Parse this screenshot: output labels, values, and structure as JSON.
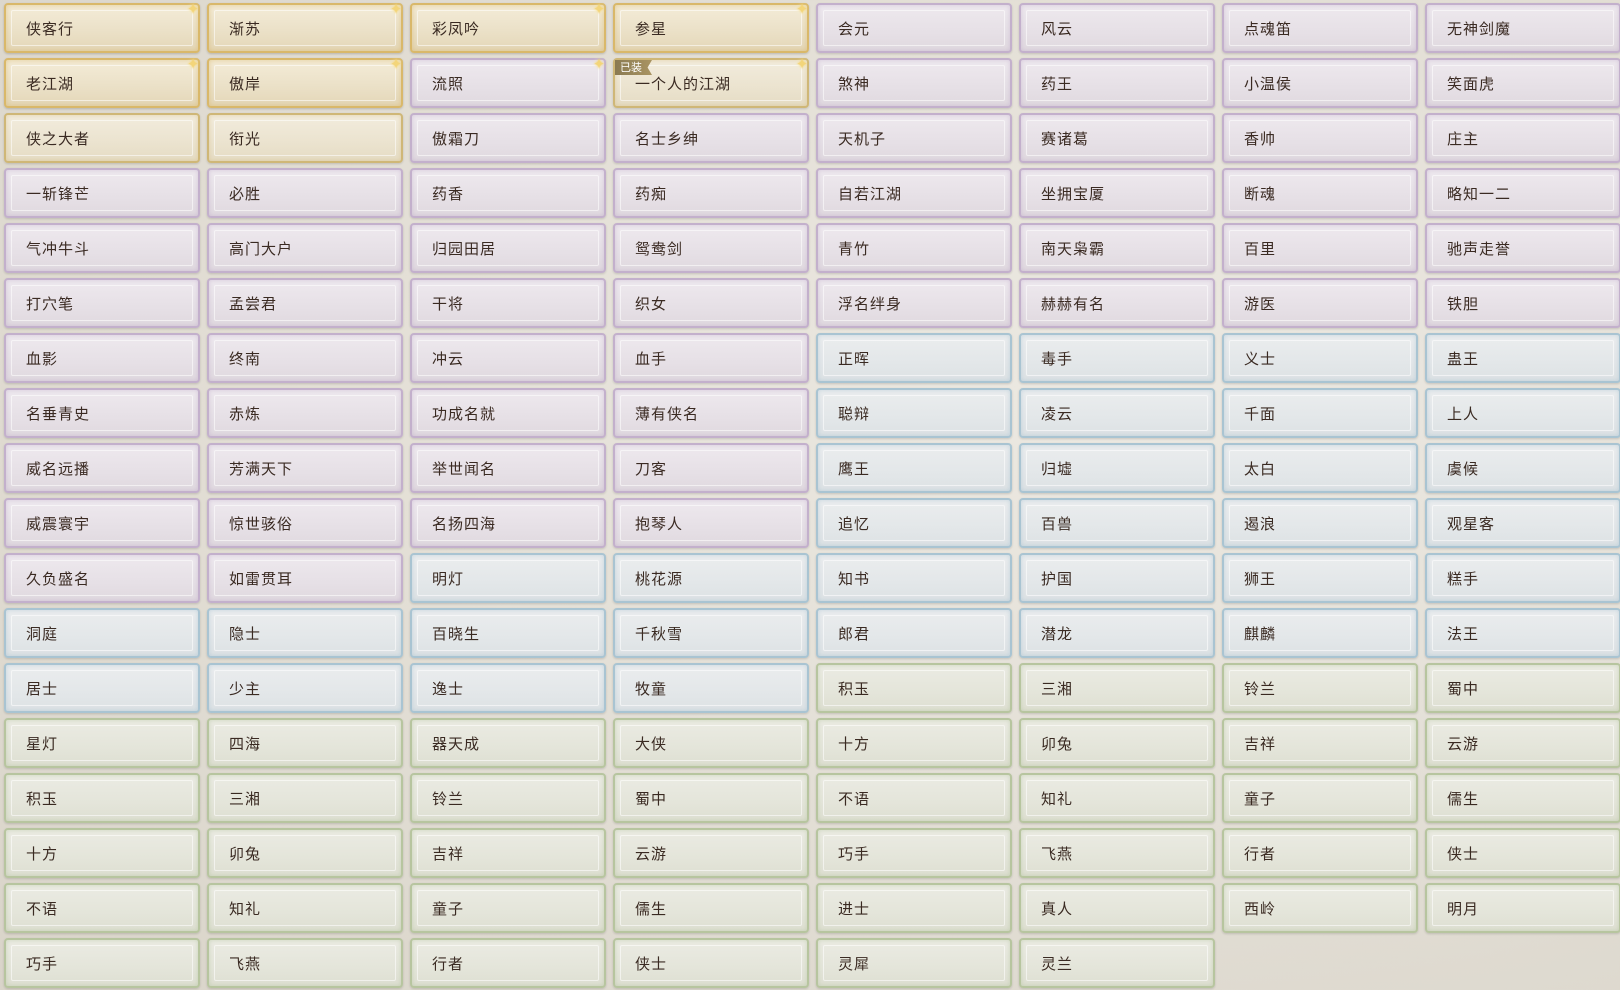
{
  "equipped_badge": "已装",
  "titles": [
    {
      "label": "侠客行",
      "tier": "gold",
      "sparkle": true
    },
    {
      "label": "渐苏",
      "tier": "gold",
      "sparkle": true
    },
    {
      "label": "彩凤吟",
      "tier": "gold",
      "sparkle": true
    },
    {
      "label": "参星",
      "tier": "gold",
      "sparkle": true
    },
    {
      "label": "会元",
      "tier": "purple"
    },
    {
      "label": "风云",
      "tier": "purple"
    },
    {
      "label": "点魂笛",
      "tier": "purple"
    },
    {
      "label": "无神剑魔",
      "tier": "purple"
    },
    {
      "label": "老江湖",
      "tier": "gold",
      "sparkle": true
    },
    {
      "label": "傲岸",
      "tier": "gold",
      "sparkle": true
    },
    {
      "label": "流照",
      "tier": "purple",
      "sparkle": true
    },
    {
      "label": "一个人的江湖",
      "tier": "gold2",
      "sparkle": true,
      "equipped": true
    },
    {
      "label": "煞神",
      "tier": "purple"
    },
    {
      "label": "药王",
      "tier": "purple"
    },
    {
      "label": "小温侯",
      "tier": "purple"
    },
    {
      "label": "笑面虎",
      "tier": "purple"
    },
    {
      "label": "侠之大者",
      "tier": "gold2"
    },
    {
      "label": "衔光",
      "tier": "gold2"
    },
    {
      "label": "傲霜刀",
      "tier": "purple"
    },
    {
      "label": "名士乡绅",
      "tier": "purple"
    },
    {
      "label": "天机子",
      "tier": "purple"
    },
    {
      "label": "赛诸葛",
      "tier": "purple"
    },
    {
      "label": "香帅",
      "tier": "purple"
    },
    {
      "label": "庄主",
      "tier": "purple"
    },
    {
      "label": "一斩锋芒",
      "tier": "purple"
    },
    {
      "label": "必胜",
      "tier": "purple"
    },
    {
      "label": "药香",
      "tier": "purple"
    },
    {
      "label": "药痴",
      "tier": "purple"
    },
    {
      "label": "自若江湖",
      "tier": "purple"
    },
    {
      "label": "坐拥宝厦",
      "tier": "purple"
    },
    {
      "label": "断魂",
      "tier": "purple"
    },
    {
      "label": "略知一二",
      "tier": "purple"
    },
    {
      "label": "气冲牛斗",
      "tier": "purple"
    },
    {
      "label": "高门大户",
      "tier": "purple"
    },
    {
      "label": "归园田居",
      "tier": "purple"
    },
    {
      "label": "鸳鸯剑",
      "tier": "purple"
    },
    {
      "label": "青竹",
      "tier": "purple"
    },
    {
      "label": "南天枭霸",
      "tier": "purple"
    },
    {
      "label": "百里",
      "tier": "purple"
    },
    {
      "label": "驰声走誉",
      "tier": "purple"
    },
    {
      "label": "打穴笔",
      "tier": "purple"
    },
    {
      "label": "孟尝君",
      "tier": "purple"
    },
    {
      "label": "干将",
      "tier": "purple"
    },
    {
      "label": "织女",
      "tier": "purple"
    },
    {
      "label": "浮名绊身",
      "tier": "purple"
    },
    {
      "label": "赫赫有名",
      "tier": "purple"
    },
    {
      "label": "游医",
      "tier": "purple"
    },
    {
      "label": "铁胆",
      "tier": "purple"
    },
    {
      "label": "血影",
      "tier": "purple"
    },
    {
      "label": "终南",
      "tier": "purple"
    },
    {
      "label": "冲云",
      "tier": "purple"
    },
    {
      "label": "血手",
      "tier": "purple"
    },
    {
      "label": "正晖",
      "tier": "blue"
    },
    {
      "label": "毒手",
      "tier": "blue"
    },
    {
      "label": "义士",
      "tier": "blue"
    },
    {
      "label": "蛊王",
      "tier": "blue"
    },
    {
      "label": "名垂青史",
      "tier": "purple"
    },
    {
      "label": "赤炼",
      "tier": "purple"
    },
    {
      "label": "功成名就",
      "tier": "purple"
    },
    {
      "label": "薄有侠名",
      "tier": "purple"
    },
    {
      "label": "聪辩",
      "tier": "blue"
    },
    {
      "label": "凌云",
      "tier": "blue"
    },
    {
      "label": "千面",
      "tier": "blue"
    },
    {
      "label": "上人",
      "tier": "blue"
    },
    {
      "label": "威名远播",
      "tier": "purple"
    },
    {
      "label": "芳满天下",
      "tier": "purple"
    },
    {
      "label": "举世闻名",
      "tier": "purple"
    },
    {
      "label": "刀客",
      "tier": "purple"
    },
    {
      "label": "鹰王",
      "tier": "blue"
    },
    {
      "label": "归墟",
      "tier": "blue"
    },
    {
      "label": "太白",
      "tier": "blue"
    },
    {
      "label": "虞候",
      "tier": "blue"
    },
    {
      "label": "威震寰宇",
      "tier": "purple"
    },
    {
      "label": "惊世骇俗",
      "tier": "purple"
    },
    {
      "label": "名扬四海",
      "tier": "purple"
    },
    {
      "label": "抱琴人",
      "tier": "purple"
    },
    {
      "label": "追忆",
      "tier": "blue"
    },
    {
      "label": "百兽",
      "tier": "blue"
    },
    {
      "label": "遏浪",
      "tier": "blue"
    },
    {
      "label": "观星客",
      "tier": "blue"
    },
    {
      "label": "久负盛名",
      "tier": "purple"
    },
    {
      "label": "如雷贯耳",
      "tier": "purple"
    },
    {
      "label": "明灯",
      "tier": "blue"
    },
    {
      "label": "桃花源",
      "tier": "blue"
    },
    {
      "label": "知书",
      "tier": "blue"
    },
    {
      "label": "护国",
      "tier": "blue"
    },
    {
      "label": "狮王",
      "tier": "blue"
    },
    {
      "label": "糕手",
      "tier": "blue"
    },
    {
      "label": "洞庭",
      "tier": "blue"
    },
    {
      "label": "隐士",
      "tier": "blue"
    },
    {
      "label": "百晓生",
      "tier": "blue"
    },
    {
      "label": "千秋雪",
      "tier": "blue"
    },
    {
      "label": "郎君",
      "tier": "blue"
    },
    {
      "label": "潜龙",
      "tier": "blue"
    },
    {
      "label": "麒麟",
      "tier": "blue"
    },
    {
      "label": "法王",
      "tier": "blue"
    },
    {
      "label": "居士",
      "tier": "blue"
    },
    {
      "label": "少主",
      "tier": "blue"
    },
    {
      "label": "逸士",
      "tier": "blue"
    },
    {
      "label": "牧童",
      "tier": "blue"
    },
    {
      "label": "积玉",
      "tier": "green"
    },
    {
      "label": "三湘",
      "tier": "green"
    },
    {
      "label": "铃兰",
      "tier": "green"
    },
    {
      "label": "蜀中",
      "tier": "green"
    },
    {
      "label": "星灯",
      "tier": "green"
    },
    {
      "label": "四海",
      "tier": "green"
    },
    {
      "label": "器天成",
      "tier": "green"
    },
    {
      "label": "大侠",
      "tier": "green"
    },
    {
      "label": "十方",
      "tier": "green"
    },
    {
      "label": "卯兔",
      "tier": "green"
    },
    {
      "label": "吉祥",
      "tier": "green"
    },
    {
      "label": "云游",
      "tier": "green"
    },
    {
      "label": "积玉",
      "tier": "green"
    },
    {
      "label": "三湘",
      "tier": "green"
    },
    {
      "label": "铃兰",
      "tier": "green"
    },
    {
      "label": "蜀中",
      "tier": "green"
    },
    {
      "label": "不语",
      "tier": "green"
    },
    {
      "label": "知礼",
      "tier": "green"
    },
    {
      "label": "童子",
      "tier": "green"
    },
    {
      "label": "儒生",
      "tier": "green"
    },
    {
      "label": "十方",
      "tier": "green"
    },
    {
      "label": "卯兔",
      "tier": "green"
    },
    {
      "label": "吉祥",
      "tier": "green"
    },
    {
      "label": "云游",
      "tier": "green"
    },
    {
      "label": "巧手",
      "tier": "green"
    },
    {
      "label": "飞燕",
      "tier": "green"
    },
    {
      "label": "行者",
      "tier": "green"
    },
    {
      "label": "侠士",
      "tier": "green"
    },
    {
      "label": "不语",
      "tier": "green"
    },
    {
      "label": "知礼",
      "tier": "green"
    },
    {
      "label": "童子",
      "tier": "green"
    },
    {
      "label": "儒生",
      "tier": "green"
    },
    {
      "label": "进士",
      "tier": "green"
    },
    {
      "label": "真人",
      "tier": "green"
    },
    {
      "label": "西岭",
      "tier": "green"
    },
    {
      "label": "明月",
      "tier": "green"
    },
    {
      "label": "巧手",
      "tier": "green"
    },
    {
      "label": "飞燕",
      "tier": "green"
    },
    {
      "label": "行者",
      "tier": "green"
    },
    {
      "label": "侠士",
      "tier": "green"
    },
    {
      "label": "灵犀",
      "tier": "green"
    },
    {
      "label": "灵兰",
      "tier": "green"
    }
  ]
}
